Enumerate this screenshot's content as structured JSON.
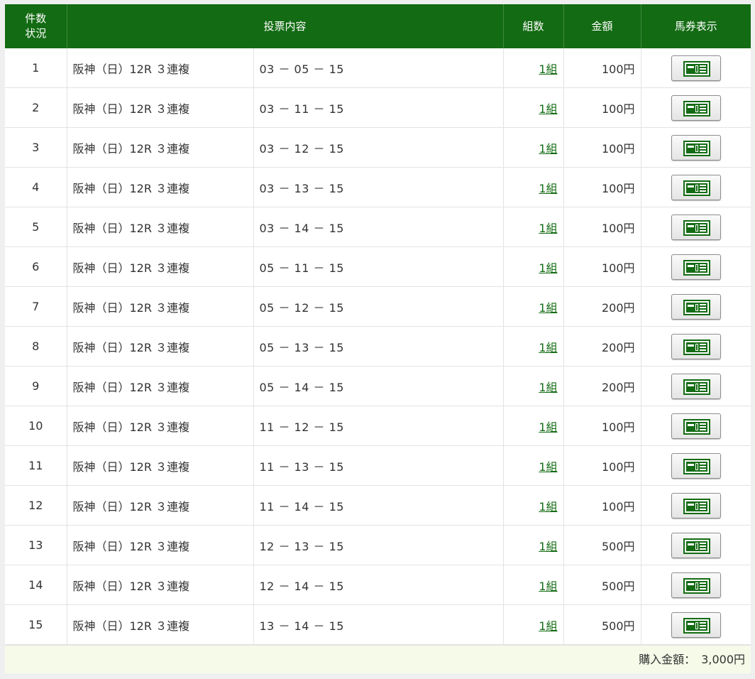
{
  "header": {
    "col_no_line1": "件数",
    "col_no_line2": "状況",
    "col_content": "投票内容",
    "col_sets": "組数",
    "col_amount": "金額",
    "col_ticket": "馬券表示"
  },
  "colors": {
    "header_bg": "#136b13",
    "link": "#136b13",
    "total_bg": "#f5fbe8"
  },
  "rows": [
    {
      "no": "1",
      "race": "阪神（日）12R ３連複",
      "combo": "03 － 05 － 15",
      "sets": "1組",
      "amount": "100円",
      "ticket_icon": "ticket-icon"
    },
    {
      "no": "2",
      "race": "阪神（日）12R ３連複",
      "combo": "03 － 11 － 15",
      "sets": "1組",
      "amount": "100円",
      "ticket_icon": "ticket-icon"
    },
    {
      "no": "3",
      "race": "阪神（日）12R ３連複",
      "combo": "03 － 12 － 15",
      "sets": "1組",
      "amount": "100円",
      "ticket_icon": "ticket-icon"
    },
    {
      "no": "4",
      "race": "阪神（日）12R ３連複",
      "combo": "03 － 13 － 15",
      "sets": "1組",
      "amount": "100円",
      "ticket_icon": "ticket-icon"
    },
    {
      "no": "5",
      "race": "阪神（日）12R ３連複",
      "combo": "03 － 14 － 15",
      "sets": "1組",
      "amount": "100円",
      "ticket_icon": "ticket-icon"
    },
    {
      "no": "6",
      "race": "阪神（日）12R ３連複",
      "combo": "05 － 11 － 15",
      "sets": "1組",
      "amount": "100円",
      "ticket_icon": "ticket-icon"
    },
    {
      "no": "7",
      "race": "阪神（日）12R ３連複",
      "combo": "05 － 12 － 15",
      "sets": "1組",
      "amount": "200円",
      "ticket_icon": "ticket-icon"
    },
    {
      "no": "8",
      "race": "阪神（日）12R ３連複",
      "combo": "05 － 13 － 15",
      "sets": "1組",
      "amount": "200円",
      "ticket_icon": "ticket-icon"
    },
    {
      "no": "9",
      "race": "阪神（日）12R ３連複",
      "combo": "05 － 14 － 15",
      "sets": "1組",
      "amount": "200円",
      "ticket_icon": "ticket-icon"
    },
    {
      "no": "10",
      "race": "阪神（日）12R ３連複",
      "combo": "11 － 12 － 15",
      "sets": "1組",
      "amount": "100円",
      "ticket_icon": "ticket-icon"
    },
    {
      "no": "11",
      "race": "阪神（日）12R ３連複",
      "combo": "11 － 13 － 15",
      "sets": "1組",
      "amount": "100円",
      "ticket_icon": "ticket-icon"
    },
    {
      "no": "12",
      "race": "阪神（日）12R ３連複",
      "combo": "11 － 14 － 15",
      "sets": "1組",
      "amount": "100円",
      "ticket_icon": "ticket-icon"
    },
    {
      "no": "13",
      "race": "阪神（日）12R ３連複",
      "combo": "12 － 13 － 15",
      "sets": "1組",
      "amount": "500円",
      "ticket_icon": "ticket-icon"
    },
    {
      "no": "14",
      "race": "阪神（日）12R ３連複",
      "combo": "12 － 14 － 15",
      "sets": "1組",
      "amount": "500円",
      "ticket_icon": "ticket-icon"
    },
    {
      "no": "15",
      "race": "阪神（日）12R ３連複",
      "combo": "13 － 14 － 15",
      "sets": "1組",
      "amount": "500円",
      "ticket_icon": "ticket-icon"
    }
  ],
  "footer": {
    "total_label": "購入金額：",
    "total_value": "3,000円"
  }
}
